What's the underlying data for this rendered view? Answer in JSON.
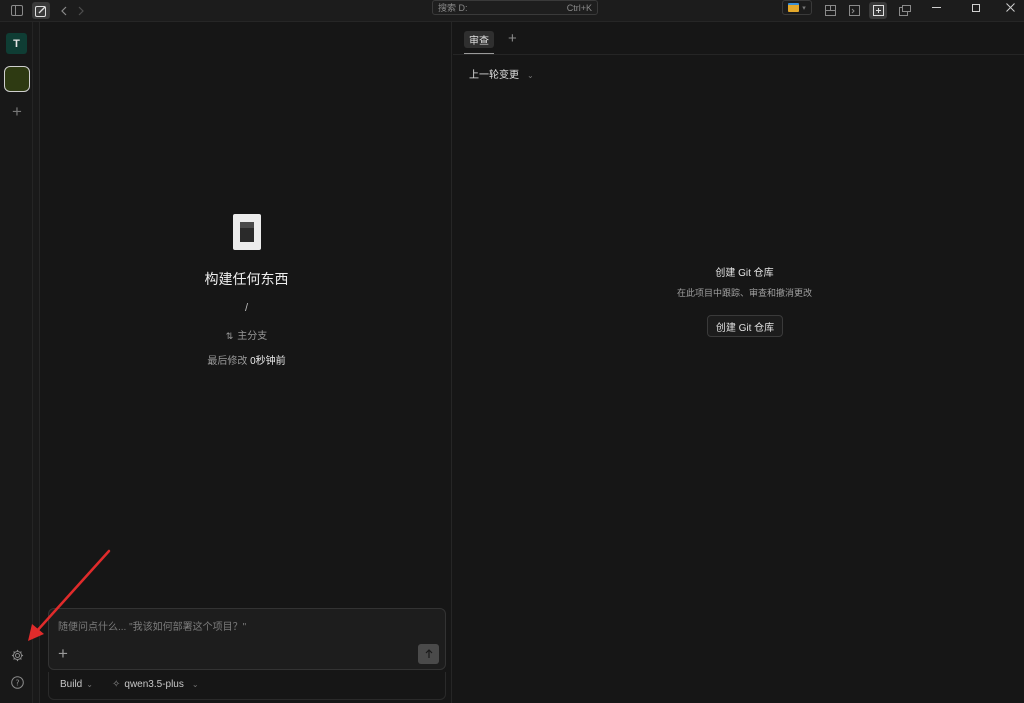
{
  "titlebar": {
    "search_placeholder": "搜索 D:",
    "search_shortcut": "Ctrl+K",
    "icons": [
      "sidebar-toggle-icon",
      "new-session-icon",
      "back-icon",
      "forward-icon",
      "folder-icon",
      "layout-icon",
      "terminal-icon",
      "review-panel-icon",
      "window-split-icon"
    ],
    "window_controls": [
      "minimize",
      "maximize",
      "close"
    ]
  },
  "rail": {
    "avatar_letter": "T",
    "avatar_color": "#0f3d34",
    "project_color": "#2e3a12"
  },
  "workspace": {
    "title": "构建任何东西",
    "path": "/",
    "branch": "主分支",
    "modified_label": "最后修改",
    "modified_value": "0秒钟前"
  },
  "composer": {
    "placeholder": "随便问点什么... \"我该如何部署这个项目？\"",
    "mode": "Build",
    "model": "qwen3.5-plus"
  },
  "review": {
    "tab_label": "审查",
    "dropdown_label": "上一轮变更",
    "git_title": "创建 Git 仓库",
    "git_desc": "在此项目中跟踪、审查和撤消更改",
    "git_button": "创建 Git 仓库"
  },
  "colors": {
    "background": "#161616",
    "annotation_arrow": "#e02b2b"
  }
}
